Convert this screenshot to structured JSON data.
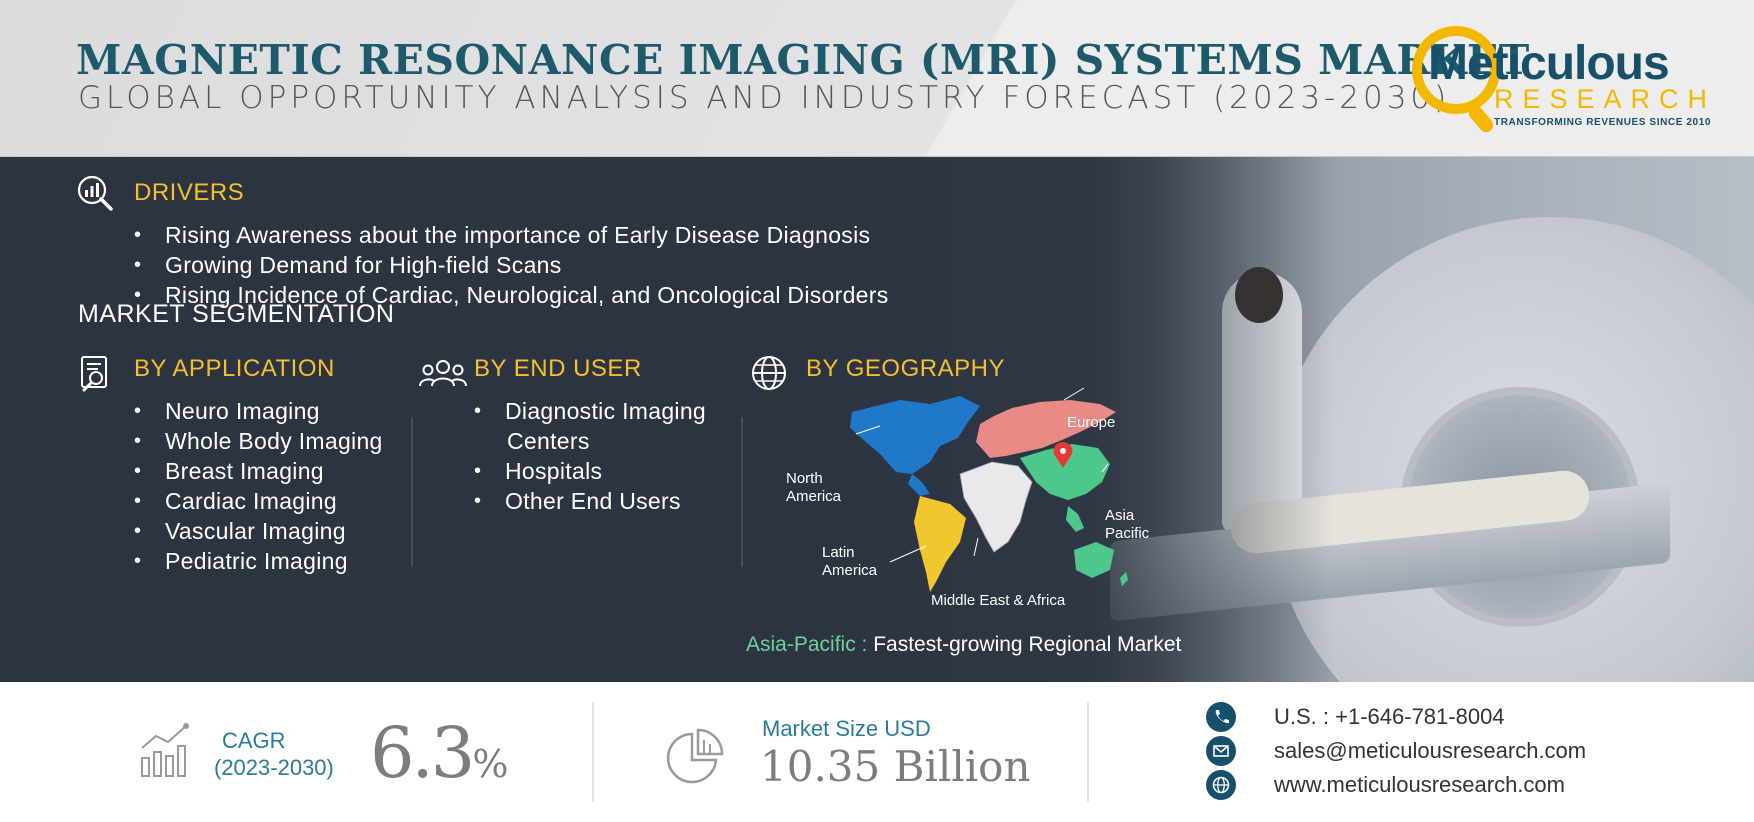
{
  "header": {
    "title": "MAGNETIC RESONANCE IMAGING (MRI) SYSTEMS MARKET",
    "subtitle": "GLOBAL OPPORTUNITY ANALYSIS AND INDUSTRY FORECAST (2023-2030)"
  },
  "logo": {
    "name": "Meticulous",
    "name2": "RESEARCH",
    "tagline": "TRANSFORMING  REVENUES  SINCE  2010"
  },
  "drivers": {
    "heading": "DRIVERS",
    "icon": "chart-magnifier-icon",
    "items": [
      "Rising Awareness about the importance of Early Disease Diagnosis",
      "Growing Demand for High-field Scans",
      "Rising Incidence of Cardiac, Neurological, and Oncological Disorders"
    ]
  },
  "segmentation": {
    "heading": "MARKET SEGMENTATION",
    "application": {
      "heading": "BY APPLICATION",
      "icon": "clipboard-magnifier-icon",
      "items": [
        "Neuro Imaging",
        "Whole Body Imaging",
        "Breast Imaging",
        "Cardiac Imaging",
        "Vascular Imaging",
        "Pediatric Imaging"
      ]
    },
    "end_user": {
      "heading": "BY END USER",
      "icon": "users-icon",
      "items": [
        "Diagnostic Imaging",
        "Centers",
        "Hospitals",
        "Other End Users"
      ]
    },
    "geography": {
      "heading": "BY GEOGRAPHY",
      "icon": "globe-icon",
      "regions": {
        "europe": "Europe",
        "north_america_1": "North",
        "north_america_2": "America",
        "asia_pacific_1": "Asia",
        "asia_pacific_2": "Pacific",
        "latin_america_1": "Latin",
        "latin_america_2": "America",
        "mea": "Middle East & Africa"
      },
      "highlight_key": "Asia-Pacific :",
      "highlight_value": "Fastest-growing Regional Market"
    }
  },
  "metrics": {
    "cagr_label": "CAGR",
    "cagr_period": "(2023-2030)",
    "cagr_value": "6.3",
    "cagr_unit": "%",
    "market_size_label": "Market Size USD",
    "market_size_value": "10.35 Billion"
  },
  "contact": {
    "phone": "U.S. : +1-646-781-8004",
    "email": "sales@meticulousresearch.com",
    "website": "www.meticulousresearch.com"
  },
  "colors": {
    "title": "#1d5a6c",
    "accent_yellow": "#f5c02e",
    "metric_blue": "#2a7a9a",
    "apac_green": "#6fcf9d",
    "dark_band": "#2c3441"
  }
}
